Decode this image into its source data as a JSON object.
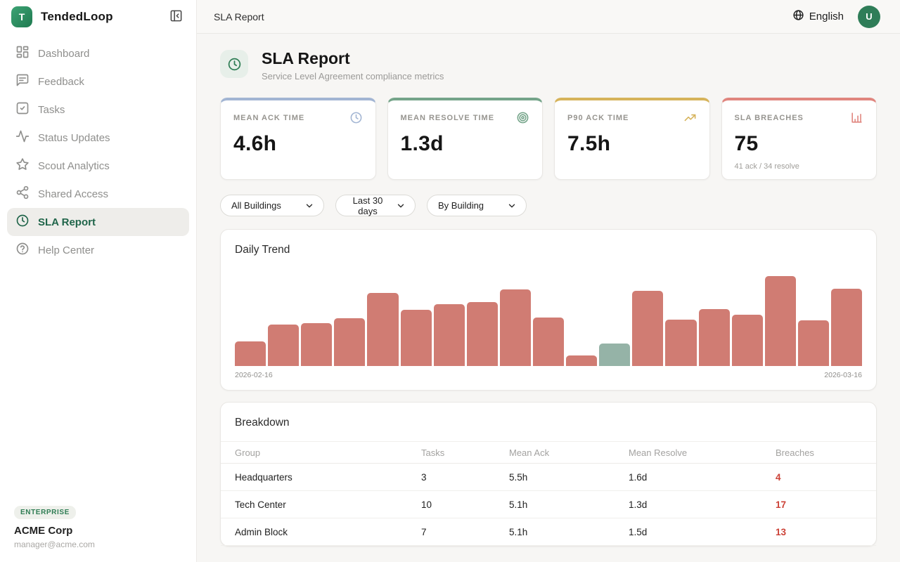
{
  "app": {
    "name": "TendedLoop",
    "logo_letter": "T"
  },
  "topbar": {
    "breadcrumb": "SLA Report",
    "language": "English",
    "avatar_letter": "U"
  },
  "sidebar": {
    "items": [
      {
        "label": "Dashboard",
        "icon": "dashboard-icon"
      },
      {
        "label": "Feedback",
        "icon": "feedback-icon"
      },
      {
        "label": "Tasks",
        "icon": "tasks-icon"
      },
      {
        "label": "Status Updates",
        "icon": "activity-icon"
      },
      {
        "label": "Scout Analytics",
        "icon": "star-icon"
      },
      {
        "label": "Shared Access",
        "icon": "share-icon"
      },
      {
        "label": "SLA Report",
        "icon": "clock-icon",
        "active": true
      },
      {
        "label": "Help Center",
        "icon": "help-icon"
      }
    ],
    "footer": {
      "badge": "ENTERPRISE",
      "org": "ACME Corp",
      "email": "manager@acme.com"
    }
  },
  "page": {
    "title": "SLA Report",
    "subtitle": "Service Level Agreement compliance metrics"
  },
  "stats": [
    {
      "label": "MEAN ACK TIME",
      "value": "4.6h",
      "icon": "clock-icon",
      "accent": "#a2b5d3"
    },
    {
      "label": "MEAN RESOLVE TIME",
      "value": "1.3d",
      "icon": "target-icon",
      "accent": "#74a489"
    },
    {
      "label": "P90 ACK TIME",
      "value": "7.5h",
      "icon": "trending-up-icon",
      "accent": "#d6b35a"
    },
    {
      "label": "SLA BREACHES",
      "value": "75",
      "sub": "41 ack / 34 resolve",
      "icon": "bar-chart-icon",
      "accent": "#e0857e"
    }
  ],
  "filters": [
    {
      "value": "All Buildings"
    },
    {
      "value": "Last 30 days"
    },
    {
      "value": "By Building"
    }
  ],
  "chart_data": {
    "type": "bar",
    "title": "Daily Trend",
    "x_start_label": "2026-02-16",
    "x_end_label": "2026-03-16",
    "values": [
      35,
      59,
      61,
      68,
      104,
      80,
      88,
      91,
      109,
      69,
      15,
      32,
      107,
      66,
      81,
      73,
      128,
      65,
      110
    ],
    "ylim": [
      0,
      135
    ],
    "bar_color": "#d07c73",
    "highlight_index": 11,
    "highlight_color": "#95b3a7",
    "grid": false,
    "legend": false
  },
  "breakdown": {
    "title": "Breakdown",
    "columns": [
      "Group",
      "Tasks",
      "Mean Ack",
      "Mean Resolve",
      "Breaches"
    ],
    "rows": [
      {
        "group": "Headquarters",
        "tasks": "3",
        "mean_ack": "5.5h",
        "mean_resolve": "1.6d",
        "breaches": "4"
      },
      {
        "group": "Tech Center",
        "tasks": "10",
        "mean_ack": "5.1h",
        "mean_resolve": "1.3d",
        "breaches": "17"
      },
      {
        "group": "Admin Block",
        "tasks": "7",
        "mean_ack": "5.1h",
        "mean_resolve": "1.5d",
        "breaches": "13"
      }
    ]
  }
}
